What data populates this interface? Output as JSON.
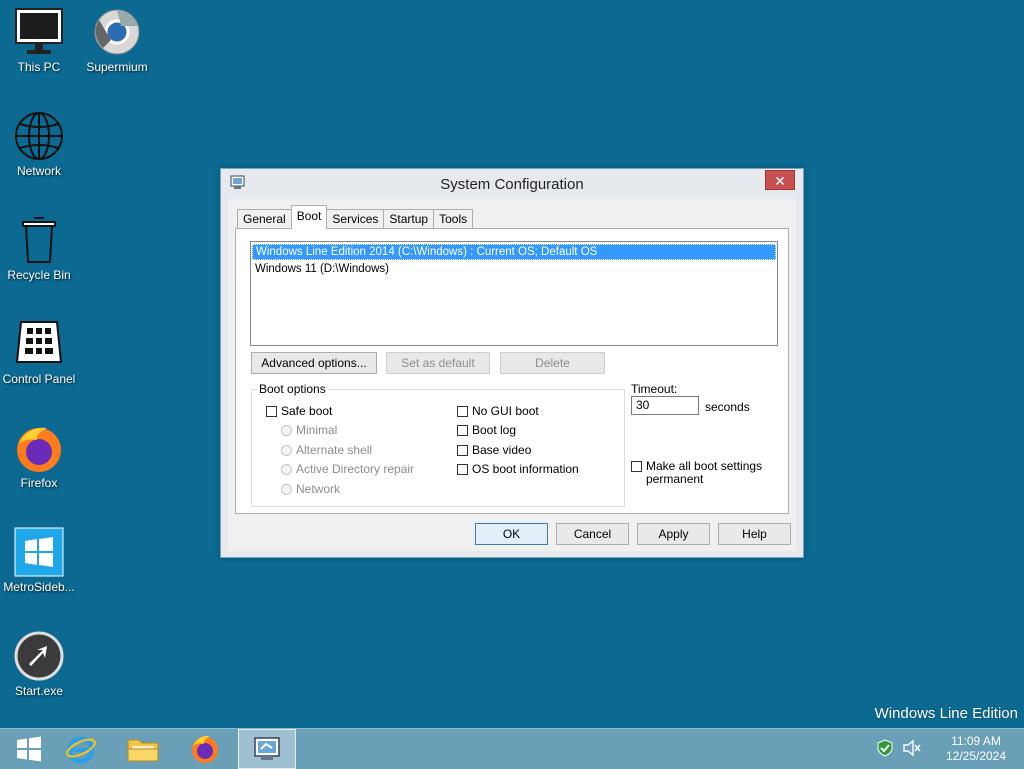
{
  "desktop": {
    "icons": [
      {
        "label": "This PC"
      },
      {
        "label": "Supermium"
      },
      {
        "label": "Network"
      },
      {
        "label": "Recycle Bin"
      },
      {
        "label": "Control Panel"
      },
      {
        "label": "Firefox"
      },
      {
        "label": "MetroSideb..."
      },
      {
        "label": "Start.exe"
      }
    ],
    "edition_text": "Windows Line Edition"
  },
  "dialog": {
    "title": "System Configuration",
    "close_glyph": "✕",
    "tabs": [
      {
        "label": "General"
      },
      {
        "label": "Boot",
        "selected": true
      },
      {
        "label": "Services"
      },
      {
        "label": "Startup"
      },
      {
        "label": "Tools"
      }
    ],
    "os_list": [
      {
        "label": "Windows Line Edition 2014 (C:\\Windows) : Current OS; Default OS",
        "selected": true
      },
      {
        "label": "Windows 11 (D:\\Windows)",
        "selected": false
      }
    ],
    "buttons": {
      "advanced": "Advanced options...",
      "set_default": "Set as default",
      "delete": "Delete"
    },
    "boot_options": {
      "legend": "Boot options",
      "safe_boot": "Safe boot",
      "minimal": "Minimal",
      "alternate_shell": "Alternate shell",
      "ad_repair": "Active Directory repair",
      "network": "Network",
      "no_gui_boot": "No GUI boot",
      "boot_log": "Boot log",
      "base_video": "Base video",
      "os_boot_info": "OS boot information"
    },
    "timeout": {
      "label": "Timeout:",
      "value": "30",
      "unit": "seconds"
    },
    "make_permanent": {
      "line1": "Make all boot settings",
      "line2": "permanent"
    },
    "footer": {
      "ok": "OK",
      "cancel": "Cancel",
      "apply": "Apply",
      "help": "Help"
    }
  },
  "taskbar": {
    "time": "11:09 AM",
    "date": "12/25/2024"
  },
  "colors": {
    "desktop": "#0c6a92",
    "taskbar": "#6a9fb8",
    "selection": "#3399ff",
    "close": "#c75050"
  }
}
